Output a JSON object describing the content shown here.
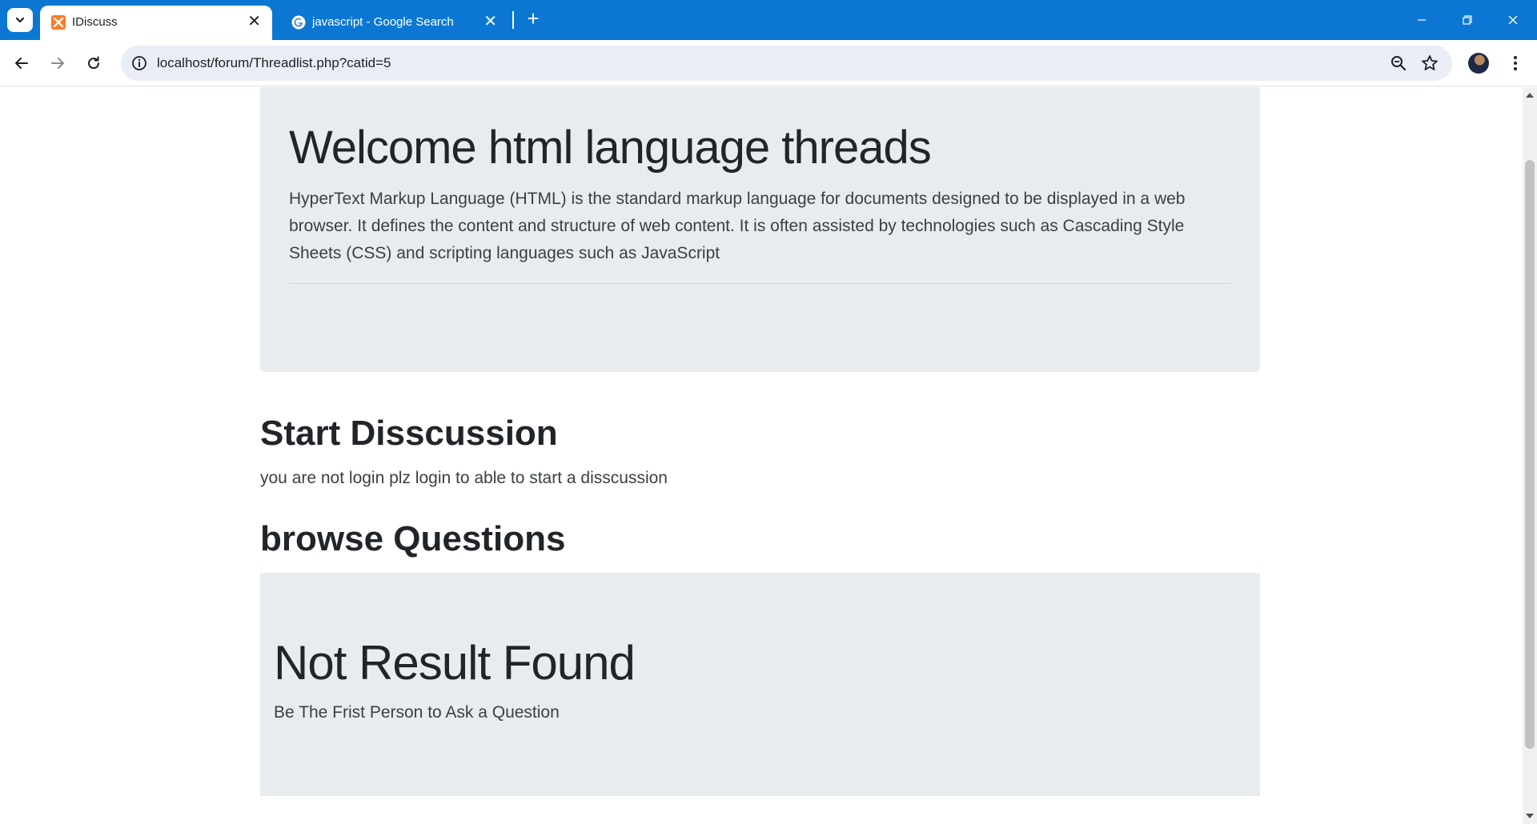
{
  "browser": {
    "tabs": [
      {
        "title": "IDiscuss",
        "active": true,
        "favicon": "xampp-icon"
      },
      {
        "title": "javascript - Google Search",
        "active": false,
        "favicon": "google-g-icon"
      }
    ],
    "url": "localhost/forum/Threadlist.php?catid=5"
  },
  "jumbotron": {
    "heading": "Welcome html language threads",
    "lead": "HyperText Markup Language (HTML) is the standard markup language for documents designed to be displayed in a web browser. It defines the content and structure of web content. It is often assisted by technologies such as Cascading Style Sheets (CSS) and scripting languages such as JavaScript"
  },
  "start_discussion": {
    "title": "Start Disscussion",
    "note": "you are not login plz login to able to start a disscussion"
  },
  "browse": {
    "title": "browse Questions",
    "empty_heading": "Not Result Found",
    "empty_sub": "Be The Frist Person to Ask a Question"
  },
  "colors": {
    "titlebar": "#0b77d3",
    "jumbotron_bg": "#e9ecef",
    "text": "#212529"
  }
}
